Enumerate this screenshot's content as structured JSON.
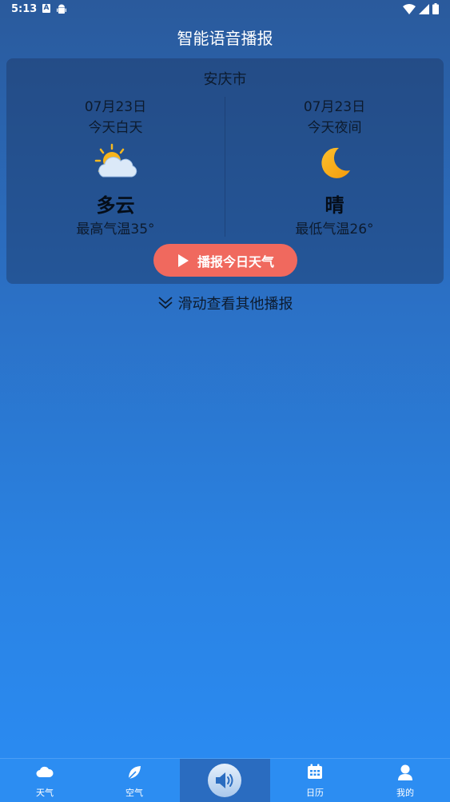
{
  "status_bar": {
    "time": "5:13",
    "left_icons": [
      "a-icon",
      "android-icon"
    ],
    "right_icons": [
      "wifi-icon",
      "signal-icon",
      "battery-icon"
    ]
  },
  "header": {
    "title": "智能语音播报"
  },
  "card": {
    "city": "安庆市",
    "day": {
      "date": "07月23日",
      "period": "今天白天",
      "icon": "partly-cloudy-icon",
      "condition": "多云",
      "temp": "最高气温35°"
    },
    "night": {
      "date": "07月23日",
      "period": "今天夜间",
      "icon": "moon-icon",
      "condition": "晴",
      "temp": "最低气温26°"
    },
    "button_label": "播报今日天气"
  },
  "more_hint": "滑动查看其他播报",
  "bottom_nav": {
    "items": [
      {
        "label": "天气",
        "icon": "weather-icon"
      },
      {
        "label": "空气",
        "icon": "leaf-icon"
      },
      {
        "label": "",
        "icon": "speaker-icon"
      },
      {
        "label": "日历",
        "icon": "calendar-icon"
      },
      {
        "label": "我的",
        "icon": "profile-icon"
      }
    ]
  },
  "colors": {
    "accent_button": "#f0695e",
    "nav_bg": "#2c8df2",
    "nav_active_bg": "#2a6cc0"
  }
}
